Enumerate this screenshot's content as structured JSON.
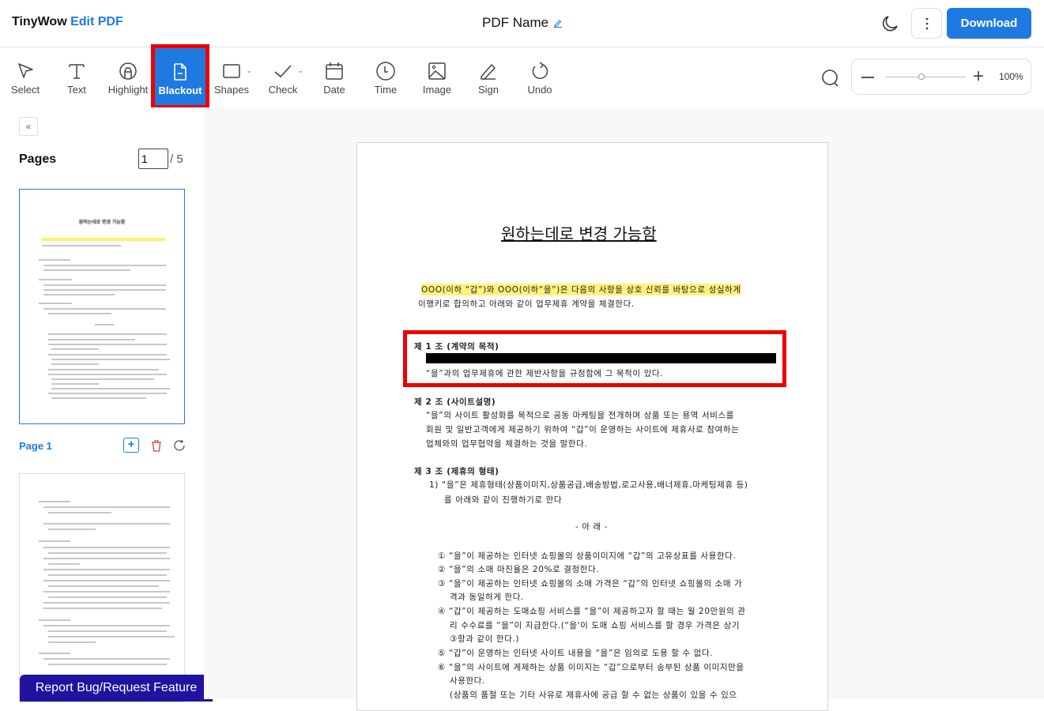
{
  "header": {
    "brand": "TinyWow",
    "brand_accent": "Edit PDF",
    "pdf_name": "PDF Name",
    "download_label": "Download",
    "icons": [
      "moon-icon",
      "more-vertical-icon",
      "edit-pencil-icon"
    ]
  },
  "toolbar": {
    "tools": [
      {
        "label": "Select",
        "icon": "cursor-arrow-icon"
      },
      {
        "label": "Text",
        "icon": "text-t-icon"
      },
      {
        "label": "Highlight",
        "icon": "highlighter-icon"
      },
      {
        "label": "Blackout",
        "icon": "file-minus-icon",
        "active": true
      },
      {
        "label": "Shapes",
        "icon": "square-icon"
      },
      {
        "label": "Check",
        "icon": "checkmark-icon"
      },
      {
        "label": "Date",
        "icon": "calendar-icon"
      },
      {
        "label": "Time",
        "icon": "clock-icon"
      },
      {
        "label": "Image",
        "icon": "image-icon"
      },
      {
        "label": "Sign",
        "icon": "pen-icon"
      },
      {
        "label": "Undo",
        "icon": "undo-icon"
      }
    ],
    "zoom_percent": "100%",
    "zoom_level": 0.5
  },
  "sidebar": {
    "collapse_label": "«",
    "pages_label": "Pages",
    "current_page": "1",
    "total_pages": "/ 5",
    "page1_label": "Page 1",
    "add_label": "+",
    "report_label": "Report Bug/Request Feature"
  },
  "document": {
    "title": "원하는데로 변경 가능함",
    "intro_highlight": "OOO(이하 “갑”)와 OOO(이하“을”)은 다음의 사항을 상호 신뢰를 바탕으로 성실하게",
    "intro_rest": "이행키로 합의하고 아래와 같이 업무제휴 계약을 체결한다.",
    "art1_title": "제 1 조 (계약의 목적)",
    "art1_line2": "“을”과의 업무제휴에 관한 제반사항을 규정함에 그 목적이 있다.",
    "art2_title": "제 2 조 (사이트설명)",
    "art2_lines": [
      "“을”의 사이트 활성화를 목적으로 공동 마케팅을 전개하며 상품 또는 용역 서비스를",
      "회원 및 일반고객에게 제공하기 위하여 “갑”이 운영하는 사이트에 제휴사로 참여하는",
      "업체와의 업무협약을 체결하는 것을 말한다."
    ],
    "art3_title": "제 3 조 (제휴의 형태)",
    "art3_lines": [
      "1) “을”은  제휴형태(상품이미지,상품공급,배송방법,로고사용,배너제휴,마케팅제휴  등)",
      "를 아래와 같이 진행하기로 한다"
    ],
    "below": "- 아    래 -",
    "items": [
      "① “을”이 제공하는 인터넷 쇼핑몰의 상품이미지에 “갑”의 고유상표를 사용한다.",
      "② “을”의 소매 마진율은 20%로 결정한다.",
      "③ “을”이 제공하는 인터넷 쇼핑몰의 소매 가격은 “갑”의 인터넷 쇼핑몰의 소매 가",
      "격과 동일하게 한다.",
      "④ “갑”이 제공하는 도매쇼핑 서비스를 “을”이 제공하고자 할 때는 월 20만원의 관",
      "리 수수료를 “을”이 지급한다.(“을'이 도매 쇼핑 서비스를 할 경우 가격은 상기",
      "③항과 같이 한다.)",
      "⑤ “갑”이 운영하는 인터넷 사이트 내용을 “을”은 임의로 도용 할 수 없다.",
      "⑥ “을”의 사이트에 게제하는 상품 이미지는 “갑”으로부터 송부된 상품 이미지만을",
      "사용한다.",
      "(상품의 품절 또는 기타 사유로 제휴사에 공급 할 수 없는 상품이 있을 수 있으"
    ]
  },
  "colors": {
    "accent": "#1e7ae0",
    "report": "#1f14a0",
    "highlight": "#fff27a",
    "annotation": "#e00000"
  }
}
